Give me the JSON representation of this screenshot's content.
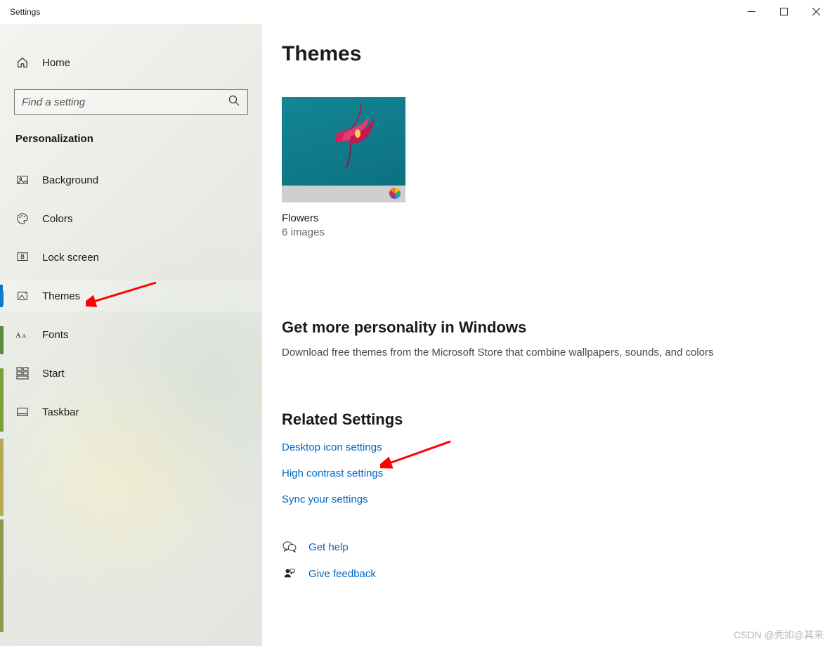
{
  "window": {
    "title": "Settings"
  },
  "sidebar": {
    "home": "Home",
    "search_placeholder": "Find a setting",
    "category": "Personalization",
    "items": [
      {
        "label": "Background",
        "selected": false
      },
      {
        "label": "Colors",
        "selected": false
      },
      {
        "label": "Lock screen",
        "selected": false
      },
      {
        "label": "Themes",
        "selected": true
      },
      {
        "label": "Fonts",
        "selected": false
      },
      {
        "label": "Start",
        "selected": false
      },
      {
        "label": "Taskbar",
        "selected": false
      }
    ]
  },
  "page": {
    "title": "Themes",
    "theme": {
      "name": "Flowers",
      "subtitle": "6 images"
    },
    "more": {
      "title": "Get more personality in Windows",
      "desc": "Download free themes from the Microsoft Store that combine wallpapers, sounds, and colors"
    },
    "related": {
      "title": "Related Settings",
      "links": [
        "Desktop icon settings",
        "High contrast settings",
        "Sync your settings"
      ]
    },
    "support": {
      "help": "Get help",
      "feedback": "Give feedback"
    }
  },
  "watermark": "CSDN @秃如@其来"
}
